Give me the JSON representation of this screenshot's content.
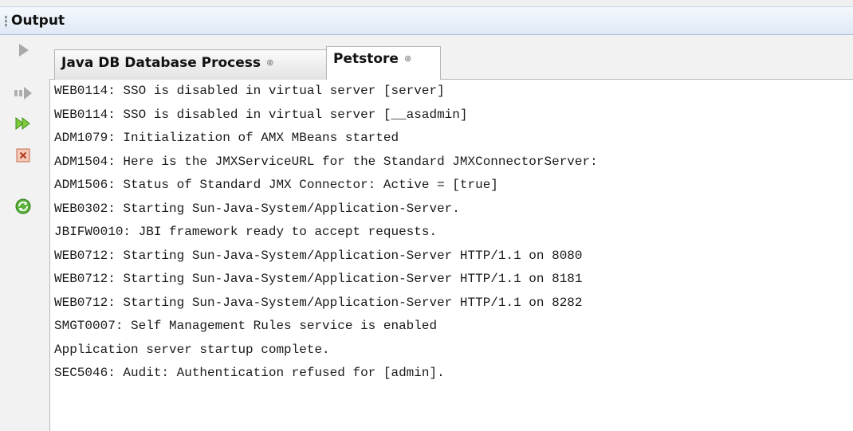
{
  "panel": {
    "title": "Output"
  },
  "toolbar": {
    "icons": [
      "rerun-icon",
      "rerun-with-options-icon",
      "resume-icon",
      "stop-icon",
      "refresh-icon"
    ]
  },
  "tabs": [
    {
      "label": "Java DB Database Process",
      "close": "⊗",
      "active": false
    },
    {
      "label": "Petstore",
      "close": "⊗",
      "active": true
    }
  ],
  "console": {
    "partial_line": "",
    "lines": [
      "WEB0114: SSO is disabled in virtual server [server]",
      "WEB0114: SSO is disabled in virtual server [__asadmin]",
      "ADM1079: Initialization of AMX MBeans started",
      "ADM1504: Here is the JMXServiceURL for the Standard JMXConnectorServer:",
      "ADM1506: Status of Standard JMX Connector: Active = [true]",
      "WEB0302: Starting Sun-Java-System/Application-Server.",
      "JBIFW0010: JBI framework ready to accept requests.",
      "WEB0712: Starting Sun-Java-System/Application-Server HTTP/1.1 on 8080",
      "WEB0712: Starting Sun-Java-System/Application-Server HTTP/1.1 on 8181",
      "WEB0712: Starting Sun-Java-System/Application-Server HTTP/1.1 on 8282",
      "SMGT0007: Self Management Rules service is enabled",
      "Application server startup complete.",
      "SEC5046: Audit: Authentication refused for [admin]."
    ]
  },
  "colors": {
    "header_bg": "#dfe9f5",
    "toolbar_bg": "#f2f2f2",
    "text": "#1a1a1a"
  }
}
